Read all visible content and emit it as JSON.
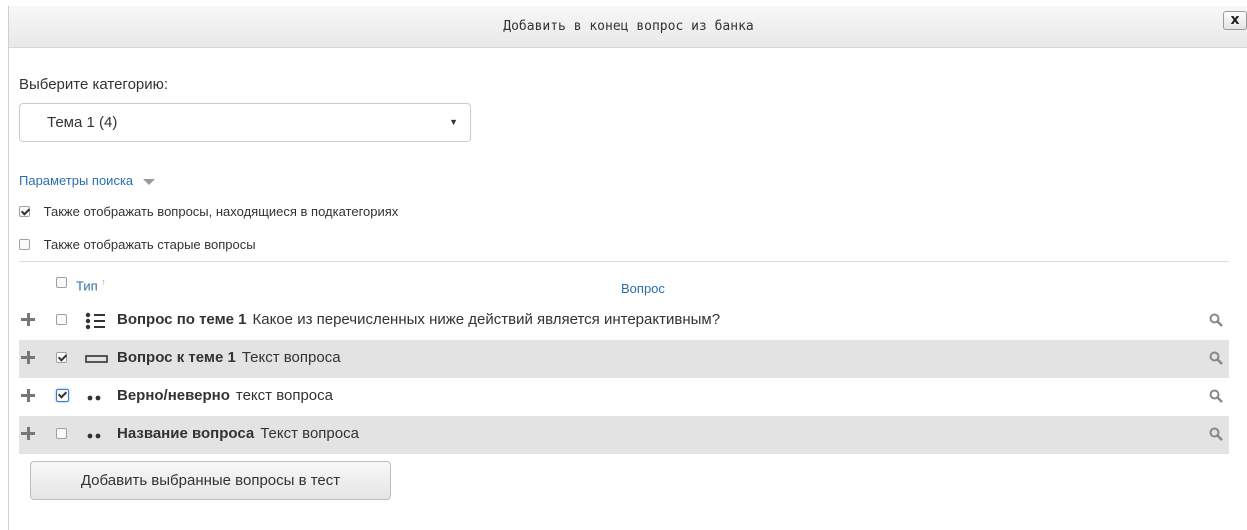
{
  "dialog": {
    "title": "Добавить в конец вопрос из банка",
    "close_label": "x"
  },
  "category": {
    "label": "Выберите категорию:",
    "selected": "Тема 1 (4)",
    "caret": "▼"
  },
  "search": {
    "link_label": "Параметры поиска",
    "option_subcategories": "Также отображать вопросы, находящиеся в подкатегориях",
    "option_subcategories_checked": true,
    "option_old": "Также отображать старые вопросы",
    "option_old_checked": false
  },
  "table": {
    "col_type": "Тип",
    "col_type_sort": "↑",
    "col_question": "Вопрос",
    "rows": [
      {
        "name": "Вопрос по теме 1",
        "text": "Какое из перечисленных ниже действий является интерактивным?",
        "icon": "multichoice-icon",
        "checked": false
      },
      {
        "name": "Вопрос к теме 1",
        "text": "Текст вопроса",
        "icon": "shortanswer-icon",
        "checked": true
      },
      {
        "name": "Верно/неверно",
        "text": "текст вопроса",
        "icon": "truefalse-icon",
        "checked": true
      },
      {
        "name": "Название вопроса",
        "text": "Текст вопроса",
        "icon": "truefalse-icon",
        "checked": false
      }
    ]
  },
  "actions": {
    "add_selected": "Добавить выбранные вопросы в тест"
  },
  "colors": {
    "link": "#2a6fad",
    "row_shade": "#e3e3e3"
  }
}
